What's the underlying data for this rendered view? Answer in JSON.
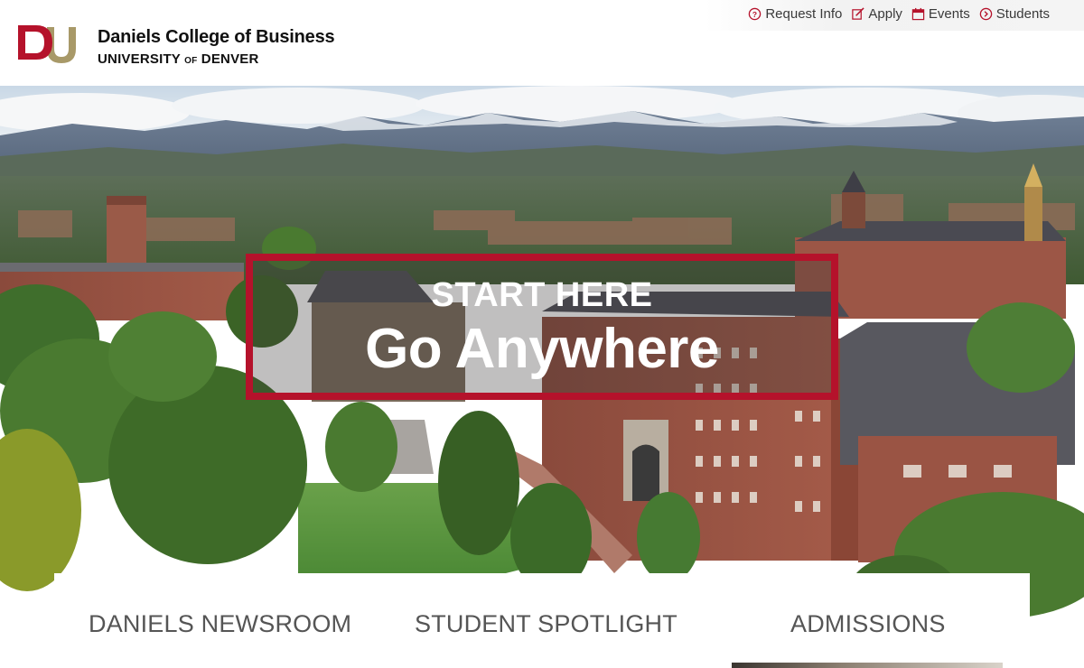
{
  "header": {
    "college_name": "Daniels College of Business",
    "university_name_pre": "UNIVERSITY",
    "university_name_of": "OF",
    "university_name_post": "DENVER",
    "logo_letters": "DU"
  },
  "utility_nav": [
    {
      "label": "Request Info",
      "icon": "question-circle-icon"
    },
    {
      "label": "Apply",
      "icon": "pencil-form-icon"
    },
    {
      "label": "Events",
      "icon": "calendar-icon"
    },
    {
      "label": "Students",
      "icon": "chevron-right-circle-icon"
    }
  ],
  "hero": {
    "kicker": "START HERE",
    "title": "Go Anywhere"
  },
  "sections": [
    {
      "label": "DANIELS NEWSROOM"
    },
    {
      "label": "STUDENT SPOTLIGHT"
    },
    {
      "label": "ADMISSIONS"
    }
  ],
  "colors": {
    "brand_red": "#b5122b",
    "brand_gold": "#a89968",
    "text_gray": "#555555"
  }
}
